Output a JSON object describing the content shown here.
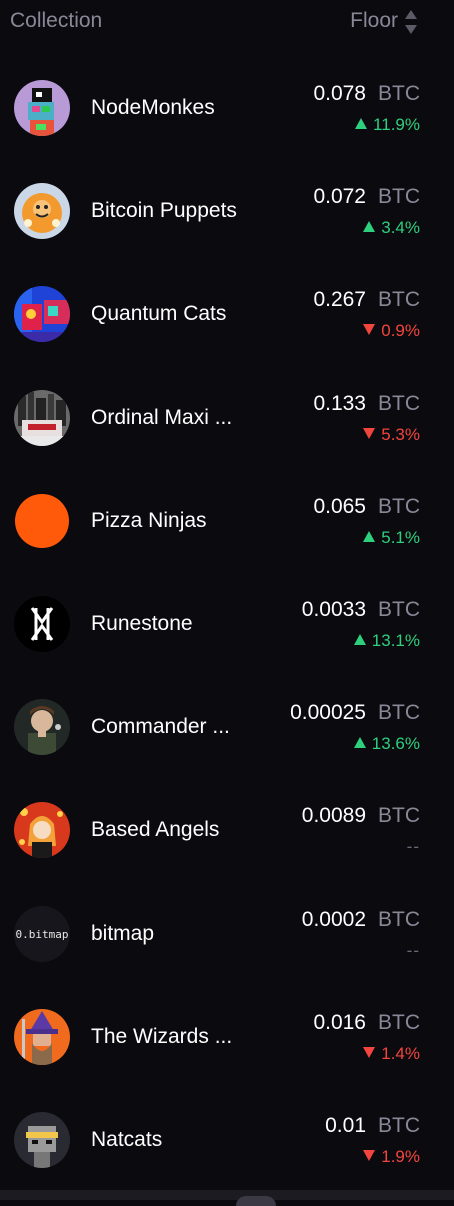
{
  "header": {
    "collection_label": "Collection",
    "floor_label": "Floor",
    "sort_icon": "sort-updown-icon"
  },
  "colors": {
    "background": "#0b0a0f",
    "muted": "#8a8797",
    "up": "#2ecf7d",
    "down": "#f2453d"
  },
  "rows": [
    {
      "name": "NodeMonkes",
      "price": "0.078",
      "unit": "BTC",
      "change": "11.9%",
      "dir": "up",
      "avatar": "nodemonkes-avatar"
    },
    {
      "name": "Bitcoin Puppets",
      "price": "0.072",
      "unit": "BTC",
      "change": "3.4%",
      "dir": "up",
      "avatar": "bitcoin-puppets-avatar"
    },
    {
      "name": "Quantum Cats",
      "price": "0.267",
      "unit": "BTC",
      "change": "0.9%",
      "dir": "down",
      "avatar": "quantum-cats-avatar"
    },
    {
      "name": "Ordinal Maxi ...",
      "price": "0.133",
      "unit": "BTC",
      "change": "5.3%",
      "dir": "down",
      "avatar": "ordinal-maxi-avatar"
    },
    {
      "name": "Pizza Ninjas",
      "price": "0.065",
      "unit": "BTC",
      "change": "5.1%",
      "dir": "up",
      "avatar": "pizza-ninjas-avatar"
    },
    {
      "name": "Runestone",
      "price": "0.0033",
      "unit": "BTC",
      "change": "13.1%",
      "dir": "up",
      "avatar": "runestone-avatar"
    },
    {
      "name": "Commander ...",
      "price": "0.00025",
      "unit": "BTC",
      "change": "13.6%",
      "dir": "up",
      "avatar": "commander-avatar"
    },
    {
      "name": "Based Angels",
      "price": "0.0089",
      "unit": "BTC",
      "change": "--",
      "dir": "none",
      "avatar": "based-angels-avatar"
    },
    {
      "name": "bitmap",
      "price": "0.0002",
      "unit": "BTC",
      "change": "--",
      "dir": "none",
      "avatar": "bitmap-avatar",
      "avatar_text": "0.bitmap"
    },
    {
      "name": "The Wizards ...",
      "price": "0.016",
      "unit": "BTC",
      "change": "1.4%",
      "dir": "down",
      "avatar": "wizards-avatar"
    },
    {
      "name": "Natcats",
      "price": "0.01",
      "unit": "BTC",
      "change": "1.9%",
      "dir": "down",
      "avatar": "natcats-avatar"
    }
  ]
}
